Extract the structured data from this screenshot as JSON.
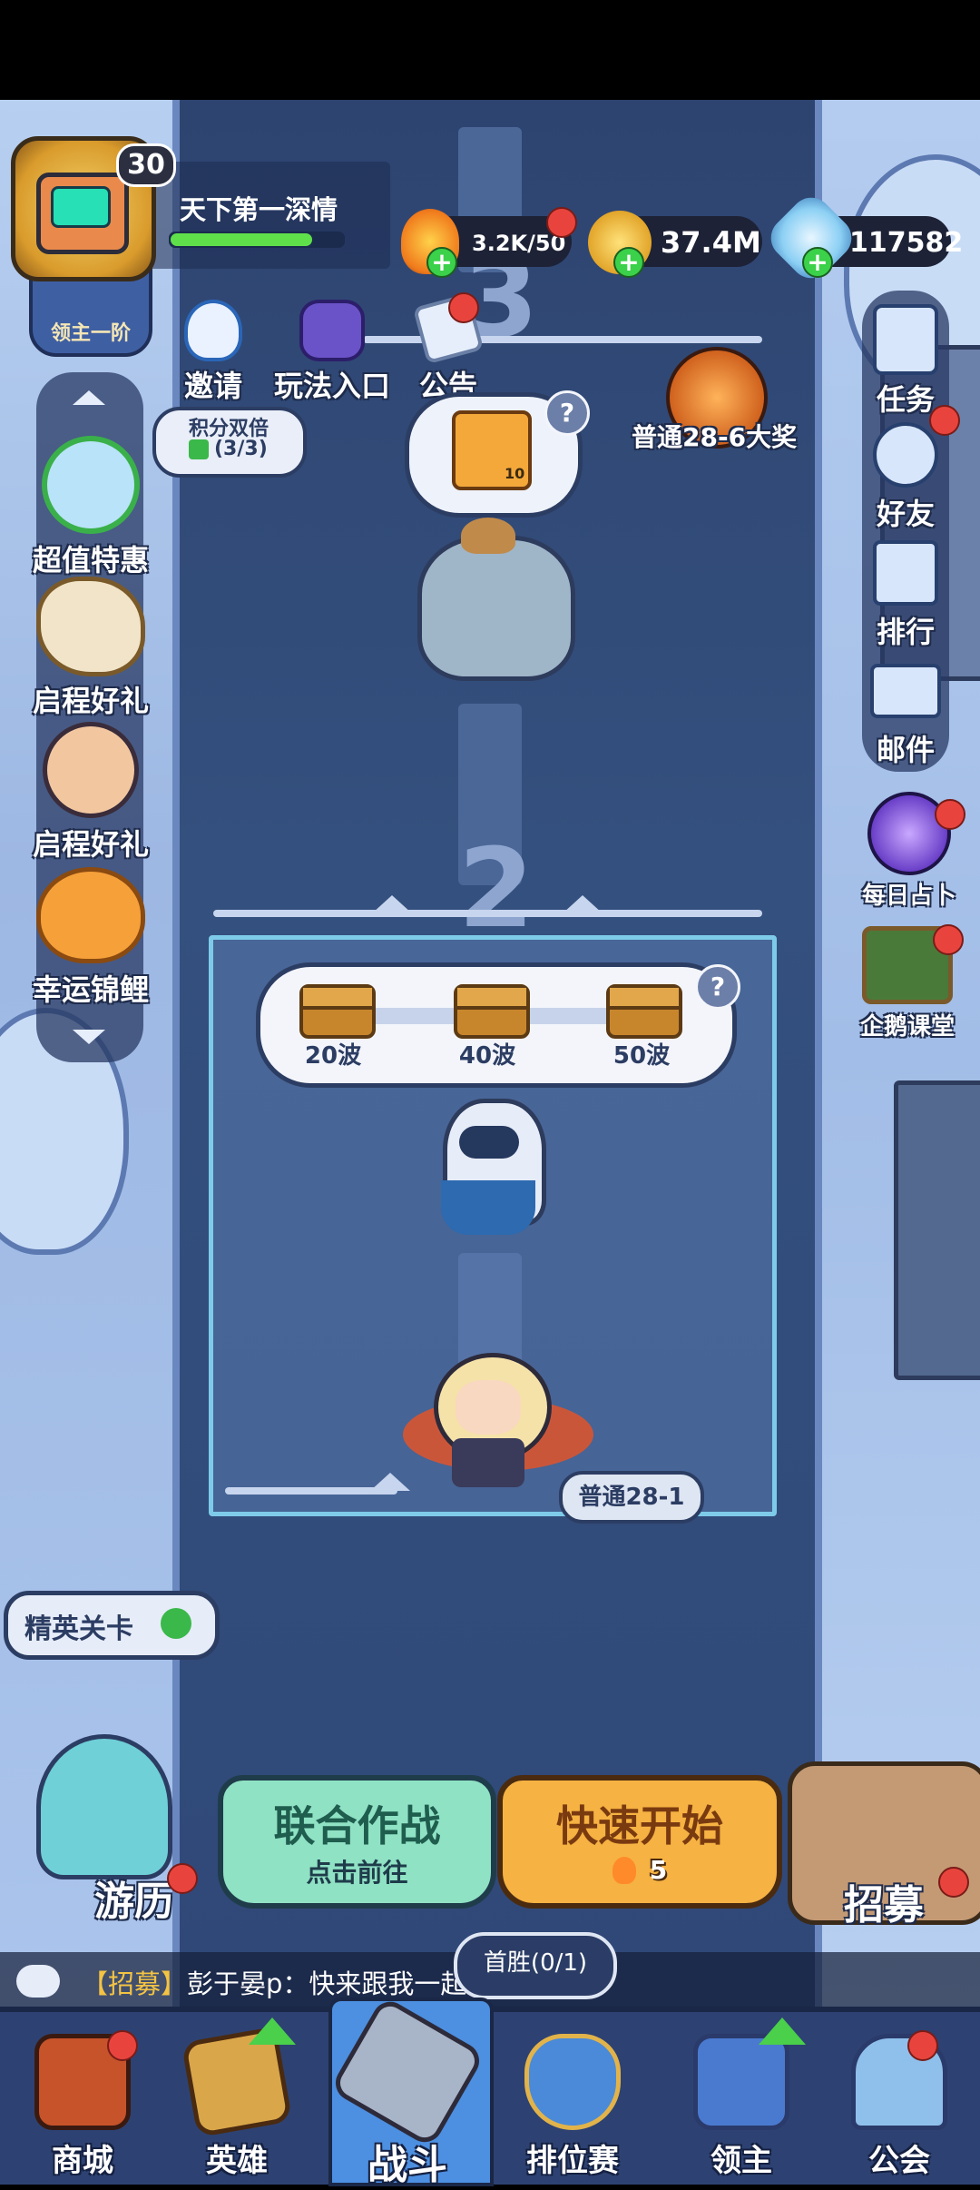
{
  "player": {
    "level": "30",
    "name": "天下第一深情",
    "rank_label": "领主一阶",
    "xp_fraction": 0.82
  },
  "resources": {
    "energy": "3.2K/50",
    "gold": "37.4M",
    "gems": "117582"
  },
  "top_actions": {
    "invite": "邀请",
    "gameplay": "玩法入口",
    "notice": "公告"
  },
  "left_menu": {
    "points_double_title": "积分双倍",
    "points_double_count": "(3/3)",
    "items": [
      "超值特惠",
      "启程好礼",
      "启程好礼",
      "幸运锦鲤"
    ]
  },
  "right_menu": {
    "items": [
      "任务",
      "好友",
      "排行",
      "邮件"
    ],
    "daily_divination": "每日占卜",
    "penguin_class": "企鹅课堂"
  },
  "stages": {
    "upper_number": "3",
    "middle_number": "2",
    "grand_prize_label": "普通28-6大奖",
    "reward_crystal_count": "10",
    "current_stage": "普通28-1",
    "wave_rewards": [
      "20波",
      "40波",
      "50波"
    ],
    "help_mark": "?"
  },
  "elite_stage": "精英关卡",
  "bottom_actions": {
    "travel": "游历",
    "recruit": "招募",
    "coop_title": "联合作战",
    "coop_sub": "点击前往",
    "quick_title": "快速开始",
    "quick_cost": "5"
  },
  "chat": {
    "tag": "【招募】",
    "message": "彭于晏p：快来跟我一起",
    "first_win": "首胜(0/1)"
  },
  "nav": {
    "shop": "商城",
    "heroes": "英雄",
    "battle": "战斗",
    "ranked": "排位赛",
    "lord": "领主",
    "guild": "公会"
  }
}
